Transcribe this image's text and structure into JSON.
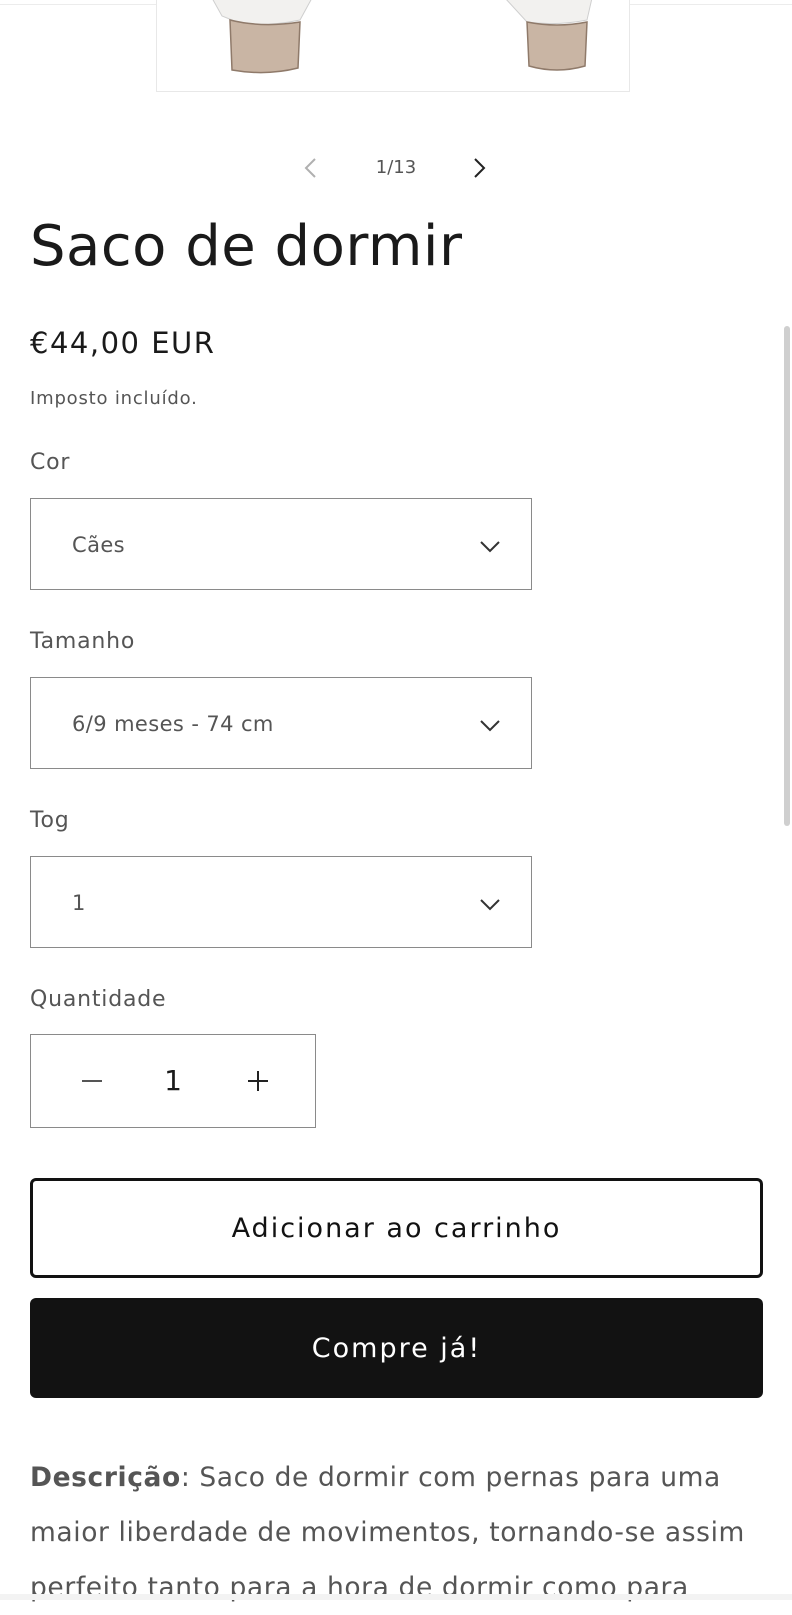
{
  "colors": {
    "text": "#121212",
    "muted": "#555555",
    "border": "#8a8a8a",
    "button_dark": "#121212",
    "button_light": "#ffffff",
    "product_fabric": "#f2f1ef",
    "product_cuff": "#c9b5a4"
  },
  "gallery": {
    "counter": "1/13",
    "prev_icon": "chevron-left-icon",
    "next_icon": "chevron-right-icon"
  },
  "product": {
    "title": "Saco de dormir",
    "price": "€44,00 EUR",
    "tax_note": "Imposto incluído."
  },
  "options": {
    "color": {
      "label": "Cor",
      "value": "Cães"
    },
    "size": {
      "label": "Tamanho",
      "value": "6/9 meses - 74 cm"
    },
    "tog": {
      "label": "Tog",
      "value": "1"
    },
    "dropdown_icon": "chevron-down-icon"
  },
  "quantity": {
    "label": "Quantidade",
    "value": "1",
    "minus_icon": "minus-icon",
    "plus_icon": "plus-icon"
  },
  "actions": {
    "add_to_cart": "Adicionar ao carrinho",
    "buy_now": "Compre já!"
  },
  "description": {
    "heading": "Descrição",
    "text": ": Saco de dormir com pernas para uma maior liberdade de movimentos, tornando-se assim perfeito tanto para a hora de dormir como para"
  }
}
